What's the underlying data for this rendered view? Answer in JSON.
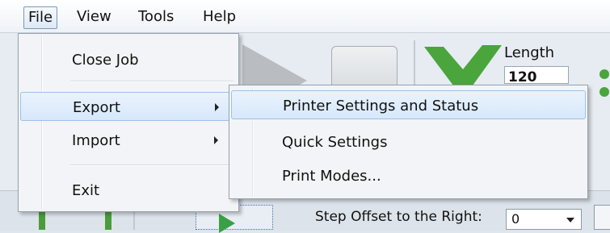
{
  "menubar": {
    "items": [
      {
        "label": "File"
      },
      {
        "label": "View"
      },
      {
        "label": "Tools"
      },
      {
        "label": "Help"
      }
    ]
  },
  "file_menu": {
    "items": [
      {
        "label": "Close Job"
      },
      {
        "label": "Export"
      },
      {
        "label": "Import"
      },
      {
        "label": "Exit"
      }
    ]
  },
  "export_submenu": {
    "items": [
      {
        "label": "Printer Settings and Status"
      },
      {
        "label": "Quick Settings"
      },
      {
        "label": "Print Modes..."
      }
    ]
  },
  "background": {
    "length_label": "Length",
    "length_value": "120",
    "step_offset_label": "Step Offset to the Right:",
    "step_offset_value": "0"
  },
  "colors": {
    "accent_green": "#4aa53c",
    "menu_highlight": "#d7e8fb"
  }
}
